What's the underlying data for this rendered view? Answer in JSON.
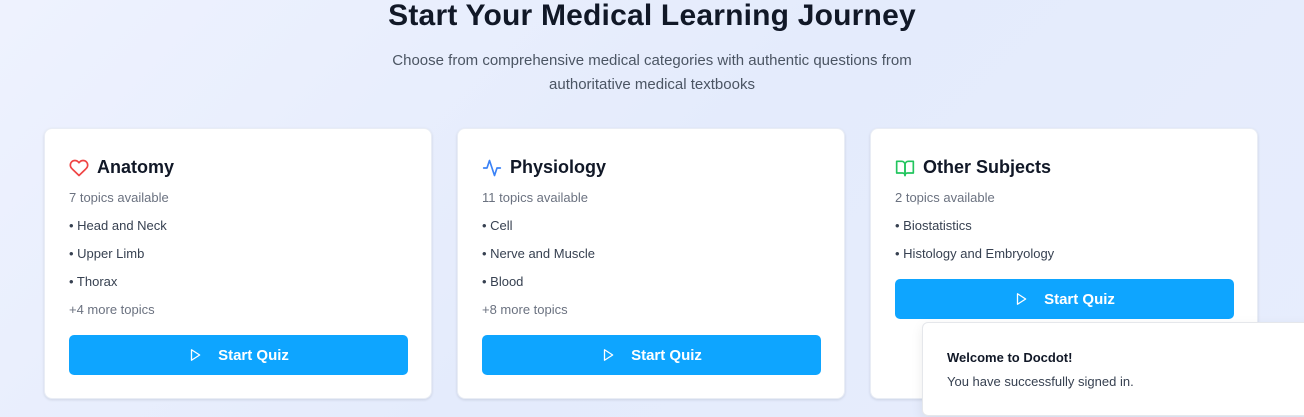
{
  "hero": {
    "title": "Start Your Medical Learning Journey",
    "subtitle_line1": "Choose from comprehensive medical categories with authentic questions from",
    "subtitle_line2": "authoritative medical textbooks"
  },
  "cards": [
    {
      "icon": "heart-icon",
      "icon_color": "#ef4444",
      "title": "Anatomy",
      "count": "7 topics available",
      "topics": [
        "• Head and Neck",
        "• Upper Limb",
        "• Thorax"
      ],
      "more": "+4 more topics",
      "button": "Start Quiz"
    },
    {
      "icon": "activity-icon",
      "icon_color": "#3b82f6",
      "title": "Physiology",
      "count": "11 topics available",
      "topics": [
        "• Cell",
        "• Nerve and Muscle",
        "• Blood"
      ],
      "more": "+8 more topics",
      "button": "Start Quiz"
    },
    {
      "icon": "book-open-icon",
      "icon_color": "#22c55e",
      "title": "Other Subjects",
      "count": "2 topics available",
      "topics": [
        "• Biostatistics",
        "• Histology and Embryology"
      ],
      "button": "Start Quiz"
    }
  ],
  "toast": {
    "title": "Welcome to Docdot!",
    "message": "You have successfully signed in."
  },
  "colors": {
    "accent": "#0ea5ff",
    "text_primary": "#111827",
    "text_muted": "#6b7280"
  }
}
